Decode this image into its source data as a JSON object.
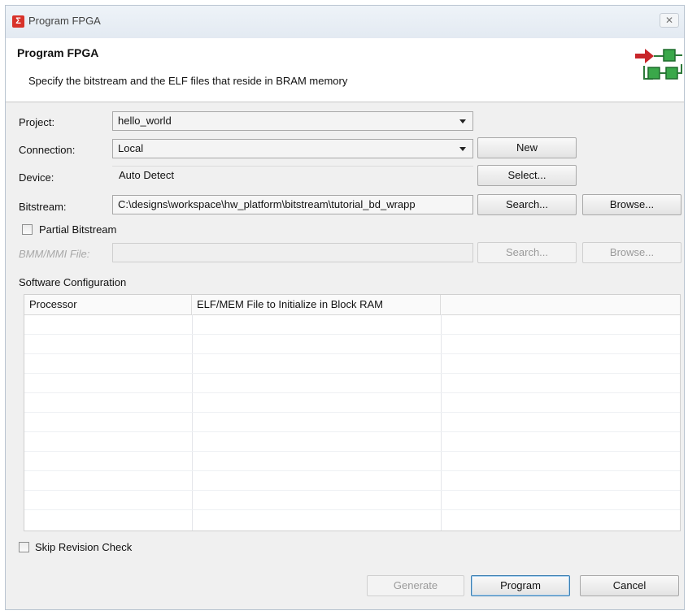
{
  "window": {
    "title": "Program FPGA"
  },
  "banner": {
    "title": "Program FPGA",
    "description": "Specify the bitstream and the ELF files that reside in BRAM memory"
  },
  "form": {
    "project_label": "Project:",
    "project_value": "hello_world",
    "connection_label": "Connection:",
    "connection_value": "Local",
    "new_button": "New",
    "device_label": "Device:",
    "device_value": "Auto Detect",
    "select_button": "Select...",
    "bitstream_label": "Bitstream:",
    "bitstream_value": "C:\\designs\\workspace\\hw_platform\\bitstream\\tutorial_bd_wrapp",
    "bitstream_search_button": "Search...",
    "bitstream_browse_button": "Browse...",
    "partial_bitstream_label": "Partial Bitstream",
    "partial_bitstream_checked": false,
    "bmm_label": "BMM/MMI File:",
    "bmm_value": "",
    "bmm_search_button": "Search...",
    "bmm_browse_button": "Browse..."
  },
  "software_config": {
    "label": "Software Configuration",
    "columns": [
      "Processor",
      "ELF/MEM File to Initialize in Block RAM",
      ""
    ],
    "rows": []
  },
  "skip_revision": {
    "label": "Skip Revision Check",
    "checked": false
  },
  "footer": {
    "generate_button": "Generate",
    "program_button": "Program",
    "cancel_button": "Cancel"
  },
  "colors": {
    "app_icon": "#d8322a",
    "arrow_red": "#c8262a",
    "block_green": "#3aa84a"
  }
}
